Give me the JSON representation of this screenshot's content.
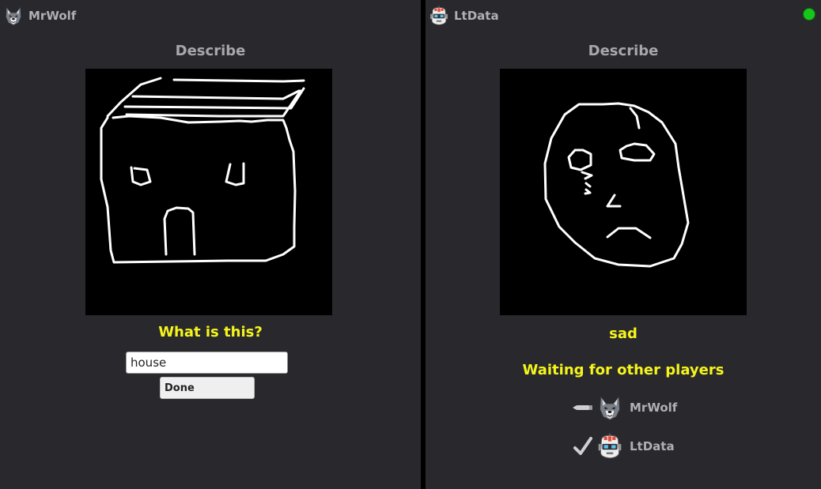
{
  "left_player": {
    "name": "MrWolf",
    "avatar_icon": "wolf-avatar",
    "section_title": "Describe",
    "question": "What is this?",
    "input_value": "house",
    "done_label": "Done",
    "drawing_subject_icon": "house-drawing"
  },
  "right_player": {
    "name": "LtData",
    "avatar_icon": "robot-avatar",
    "online_color": "#18c51b",
    "section_title": "Describe",
    "answer": "sad",
    "waiting_text": "Waiting for other players",
    "drawing_subject_icon": "sad-face-drawing",
    "players": [
      {
        "name": "MrWolf",
        "avatar_icon": "wolf-avatar",
        "state_icon": "pencil-icon"
      },
      {
        "name": "LtData",
        "avatar_icon": "robot-avatar",
        "state_icon": "checkmark-icon"
      }
    ]
  },
  "colors": {
    "panel_bg": "#29292d",
    "accent_yellow": "#f5f51c",
    "muted_text": "#a8a8ac"
  }
}
